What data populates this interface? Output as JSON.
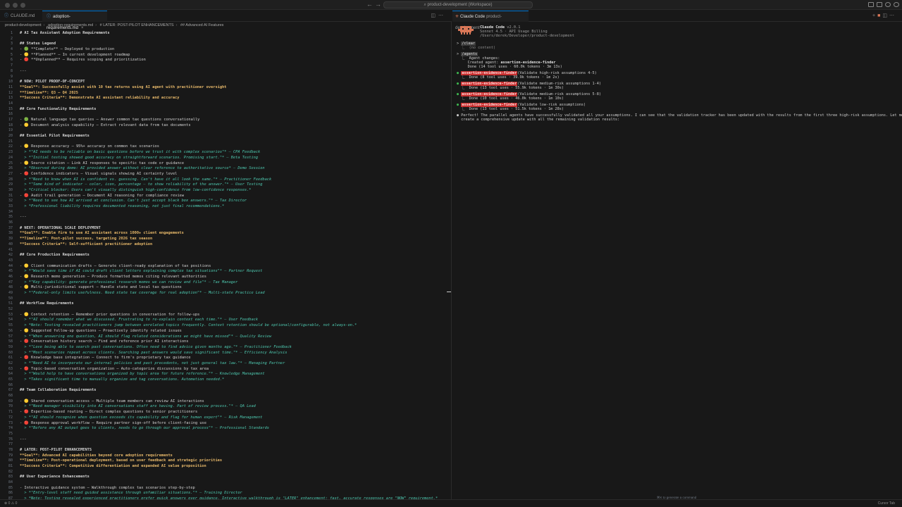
{
  "window": {
    "title": "product-development (Workspace)"
  },
  "editor": {
    "tabs": [
      {
        "label": "CLAUDE.md",
        "active": false
      },
      {
        "label": "adoption-requirements.md",
        "active": true
      }
    ],
    "breadcrumb": [
      "product-development",
      "adoption-requirements.md",
      "# LATER: POST-PILOT ENHANCEMENTS",
      "## Advanced AI Features"
    ],
    "lines": [
      {
        "n": "1",
        "t": "# AI Tax Assistant Adoption Requirements"
      },
      {
        "n": "2",
        "t": ""
      },
      {
        "n": "3",
        "t": "## Status Legend"
      },
      {
        "n": "4",
        "t": "- 🟢 **Complete** – Deployed to production"
      },
      {
        "n": "5",
        "t": "- 🟡 **Planned** – In current development roadmap"
      },
      {
        "n": "6",
        "t": "- 🔴 **Unplanned** – Requires scoping and prioritization"
      },
      {
        "n": "7",
        "t": ""
      },
      {
        "n": "8",
        "t": "---"
      },
      {
        "n": "9",
        "t": ""
      },
      {
        "n": "10",
        "t": "# NOW: PILOT PROOF-OF-CONCEPT"
      },
      {
        "n": "11",
        "t": "**Goal**: Successfully assist with 10 tax returns using AI agent with practitioner oversight"
      },
      {
        "n": "12",
        "t": "**Timeline**: Q3 – Q4 2025"
      },
      {
        "n": "13",
        "t": "**Success Criteria**: Demonstrate AI assistant reliability and accuracy"
      },
      {
        "n": "14",
        "t": ""
      },
      {
        "n": "15",
        "t": "## Core Functionality Requirements"
      },
      {
        "n": "16",
        "t": ""
      },
      {
        "n": "17",
        "t": "- 🟢 Natural language tax queries – Answer common tax questions conversationally"
      },
      {
        "n": "18",
        "t": "- 🟡 Document analysis capability – Extract relevant data from tax documents"
      },
      {
        "n": "19",
        "t": ""
      },
      {
        "n": "20",
        "t": "## Essential Pilot Requirements"
      },
      {
        "n": "21",
        "t": ""
      },
      {
        "n": "22",
        "t": "- 🟡 Response accuracy – 95%+ accuracy on common tax scenarios"
      },
      {
        "n": "23",
        "t": "  > *\"AI needs to be reliable on basic questions before we trust it with complex scenarios\"* – CPA Feedback"
      },
      {
        "n": "24",
        "t": "  > *\"Initial testing showed good accuracy on straightforward scenarios. Promising start.\"* – Beta Testing"
      },
      {
        "n": "25",
        "t": "- 🟡 Source citation – Link AI responses to specific tax code or guidance"
      },
      {
        "n": "26",
        "t": "  > *Observed during demo: AI provided answer without clear reference to authoritative source* – Demo Session"
      },
      {
        "n": "27",
        "t": "- 🔴 Confidence indicators – Visual signals showing AI certainty level"
      },
      {
        "n": "28",
        "t": "  > *\"Need to know when AI is confident vs. guessing. Can't have it all look the same.\"* – Practitioner Feedback"
      },
      {
        "n": "29",
        "t": "  > *\"Some kind of indicator – color, icon, percentage – to show reliability of the answer.\"* – User Testing"
      },
      {
        "n": "30",
        "t": "  > *Critical blocker: Users can't visually distinguish high-confidence from low-confidence responses.*"
      },
      {
        "n": "31",
        "t": "- 🔴 Audit trail generation – Document AI reasoning for compliance review"
      },
      {
        "n": "32",
        "t": "  > *\"Need to see how AI arrived at conclusion. Can't just accept black box answers.\"* – Tax Director"
      },
      {
        "n": "33",
        "t": "  > *Professional liability requires documented reasoning, not just final recommendations.*"
      },
      {
        "n": "34",
        "t": ""
      },
      {
        "n": "35",
        "t": "---"
      },
      {
        "n": "36",
        "t": ""
      },
      {
        "n": "37",
        "t": "# NEXT: OPERATIONAL SCALE DEPLOYMENT"
      },
      {
        "n": "38",
        "t": "**Goal**: Enable firm to use AI assistant across 1000+ client engagements"
      },
      {
        "n": "39",
        "t": "**Timeline**: Post-pilot success, targeting 2026 tax season"
      },
      {
        "n": "40",
        "t": "**Success Criteria**: Self-sufficient practitioner adoption"
      },
      {
        "n": "41",
        "t": ""
      },
      {
        "n": "42",
        "t": "## Core Production Requirements"
      },
      {
        "n": "43",
        "t": ""
      },
      {
        "n": "44",
        "t": "- 🟡 Client communication drafts – Generate client-ready explanation of tax positions"
      },
      {
        "n": "45",
        "t": "  > *\"Would save time if AI could draft client letters explaining complex tax situations\"* – Partner Request"
      },
      {
        "n": "46",
        "t": "- 🟡 Research memo generation – Produce formatted memos citing relevant authorities"
      },
      {
        "n": "47",
        "t": "  > *\"Key capability: generate professional research memos we can review and file\"* – Tax Manager"
      },
      {
        "n": "48",
        "t": "- 🟡 Multi-jurisdictional support – Handle state and local tax questions"
      },
      {
        "n": "49",
        "t": "  > *\"Federal-only limits usefulness. Need state tax coverage for real adoption\"* – Multi-state Practice Lead"
      },
      {
        "n": "50",
        "t": ""
      },
      {
        "n": "51",
        "t": "## Workflow Requirements"
      },
      {
        "n": "52",
        "t": ""
      },
      {
        "n": "53",
        "t": "- 🟡 Context retention – Remember prior questions in conversation for follow-ups"
      },
      {
        "n": "54",
        "t": "  > *\"AI should remember what we discussed. Frustrating to re-explain context each time.\"* – User Feedback"
      },
      {
        "n": "55",
        "t": "  > *Note: Testing revealed practitioners jump between unrelated topics frequently. Context retention should be optional/configurable, not always-on.*"
      },
      {
        "n": "56",
        "t": "- 🟡 Suggested follow-up questions – Proactively identify related issues"
      },
      {
        "n": "57",
        "t": "  > *\"When answering one question, AI should flag related considerations we might have missed\"* – Quality Review"
      },
      {
        "n": "58",
        "t": "- 🔴 Conversation history search – Find and reference prior AI interactions"
      },
      {
        "n": "59",
        "t": "  > *\"Love being able to search past conversations. Often need to find advice given months ago.\"* – Practitioner Feedback"
      },
      {
        "n": "60",
        "t": "  > *\"Most scenarios repeat across clients. Searching past answers would save significant time.\"* – Efficiency Analysis"
      },
      {
        "n": "61",
        "t": "- 🔴 Knowledge base integration – Connect to firm's proprietary tax guidance"
      },
      {
        "n": "62",
        "t": "  > *\"Need AI to incorporate our internal policies and past precedents, not just general tax law.\"* – Managing Partner"
      },
      {
        "n": "63",
        "t": "- 🔴 Topic-based conversation organization – Auto-categorize discussions by tax area"
      },
      {
        "n": "64",
        "t": "  > *\"Would help to have conversations organized by topic area for future reference.\"* – Knowledge Management"
      },
      {
        "n": "65",
        "t": "  > *Takes significant time to manually organize and tag conversations. Automation needed.*"
      },
      {
        "n": "66",
        "t": ""
      },
      {
        "n": "67",
        "t": "## Team Collaboration Requirements"
      },
      {
        "n": "68",
        "t": ""
      },
      {
        "n": "69",
        "t": "- 🟡 Shared conversation access – Multiple team members can review AI interactions"
      },
      {
        "n": "70",
        "t": "  > *\"Need manager visibility into AI conversations staff are having. Part of review process.\"* – QA Lead"
      },
      {
        "n": "71",
        "t": "- 🔴 Expertise-based routing – Direct complex questions to senior practitioners"
      },
      {
        "n": "72",
        "t": "  > *\"AI should recognize when question exceeds its capability and flag for human expert\"* – Risk Management"
      },
      {
        "n": "73",
        "t": "- 🔴 Response approval workflow – Require partner sign-off before client-facing use"
      },
      {
        "n": "74",
        "t": "  > *\"Before any AI output goes to clients, needs to go through our approval process\"* – Professional Standards"
      },
      {
        "n": "75",
        "t": ""
      },
      {
        "n": "76",
        "t": "---"
      },
      {
        "n": "77",
        "t": ""
      },
      {
        "n": "78",
        "t": "# LATER: POST-PILOT ENHANCEMENTS"
      },
      {
        "n": "79",
        "t": "**Goal**: Advanced AI capabilities beyond core adoption requirements"
      },
      {
        "n": "80",
        "t": "**Timeline**: Post-operational deployment, based on user feedback and strategic priorities"
      },
      {
        "n": "81",
        "t": "**Success Criteria**: Competitive differentiation and expanded AI value proposition"
      },
      {
        "n": "82",
        "t": ""
      },
      {
        "n": "83",
        "t": "## User Experience Enhancements"
      },
      {
        "n": "84",
        "t": ""
      },
      {
        "n": "85",
        "t": "- Interactive guidance system – Walkthrough complex tax scenarios step-by-step"
      },
      {
        "n": "86",
        "t": "  > *\"Entry-level staff need guided assistance through unfamiliar situations.\"* – Training Director"
      },
      {
        "n": "87",
        "t": "  > *Note: Testing revealed experienced practitioners prefer quick answers over guidance. Interactive walkthrough is \"LATER\" enhancement; fast, accurate responses are \"NOW\" requirement.*"
      }
    ]
  },
  "claude": {
    "tab_label": "Claude Code",
    "tab_sub": "product-development",
    "header": {
      "title": "Claude Code",
      "version": "v2.0.1",
      "model": "Sonnet 4.5 · API Usage Billing",
      "path": "/Users/derek/Developer/product-development"
    },
    "log": [
      {
        "k": "cmd",
        "t": "/clear"
      },
      {
        "k": "muted",
        "t": "  ⎿  (no content)"
      },
      {
        "k": "blank",
        "t": ""
      },
      {
        "k": "cmd",
        "t": "/agents"
      },
      {
        "k": "plain",
        "t": "  ⎿  Agent changes:"
      },
      {
        "k": "created",
        "t": "     Created agent: ",
        "b": "assertion-evidence-finder"
      },
      {
        "k": "plain",
        "t": "     Done (14 tool uses · 60.0k tokens · 3m 13s)"
      },
      {
        "k": "blank",
        "t": ""
      },
      {
        "k": "agent",
        "a": "assertion-evidence-finder",
        "t": "(Validate high-risk assumptions 4-5)"
      },
      {
        "k": "plain",
        "t": "  ⎿  Done (8 tool uses · 39.9k tokens · 1m 2s)"
      },
      {
        "k": "blank",
        "t": ""
      },
      {
        "k": "agent",
        "a": "assertion-evidence-finder",
        "t": "(Validate medium-risk assumptions 1-4)"
      },
      {
        "k": "plain",
        "t": "  ⎿  Done (13 tool uses · 55.9k tokens · 1m 30s)"
      },
      {
        "k": "blank",
        "t": ""
      },
      {
        "k": "agent",
        "a": "assertion-evidence-finder",
        "t": "(Validate medium-risk assumptions 5-8)"
      },
      {
        "k": "plain",
        "t": "  ⎿  Done (10 tool uses · 46.0k tokens · 1m 10s)"
      },
      {
        "k": "blank",
        "t": ""
      },
      {
        "k": "agent",
        "a": "assertion-evidence-finder",
        "t": "(Validate low-risk assumptions)"
      },
      {
        "k": "plain",
        "t": "  ⎿  Done (13 tool uses · 51.5k tokens · 1m 28s)"
      },
      {
        "k": "blank",
        "t": ""
      },
      {
        "k": "msg",
        "t": "● Perfect! The parallel agents have successfully validated all your assumptions. I can see that the validation tracker has been updated with the results from the first three high-risk assumptions. Let me"
      },
      {
        "k": "plain",
        "t": "  create a comprehensive update with all the remaining validation results:"
      }
    ],
    "hint": "⌘K to generate a command"
  },
  "status": {
    "left": "⊗ 0 ⚠ 0",
    "right": "Cursor Tab"
  },
  "colors": {
    "accent": "#0078d4",
    "claude": "#d97757",
    "agent_bg": "#c72e2e"
  }
}
